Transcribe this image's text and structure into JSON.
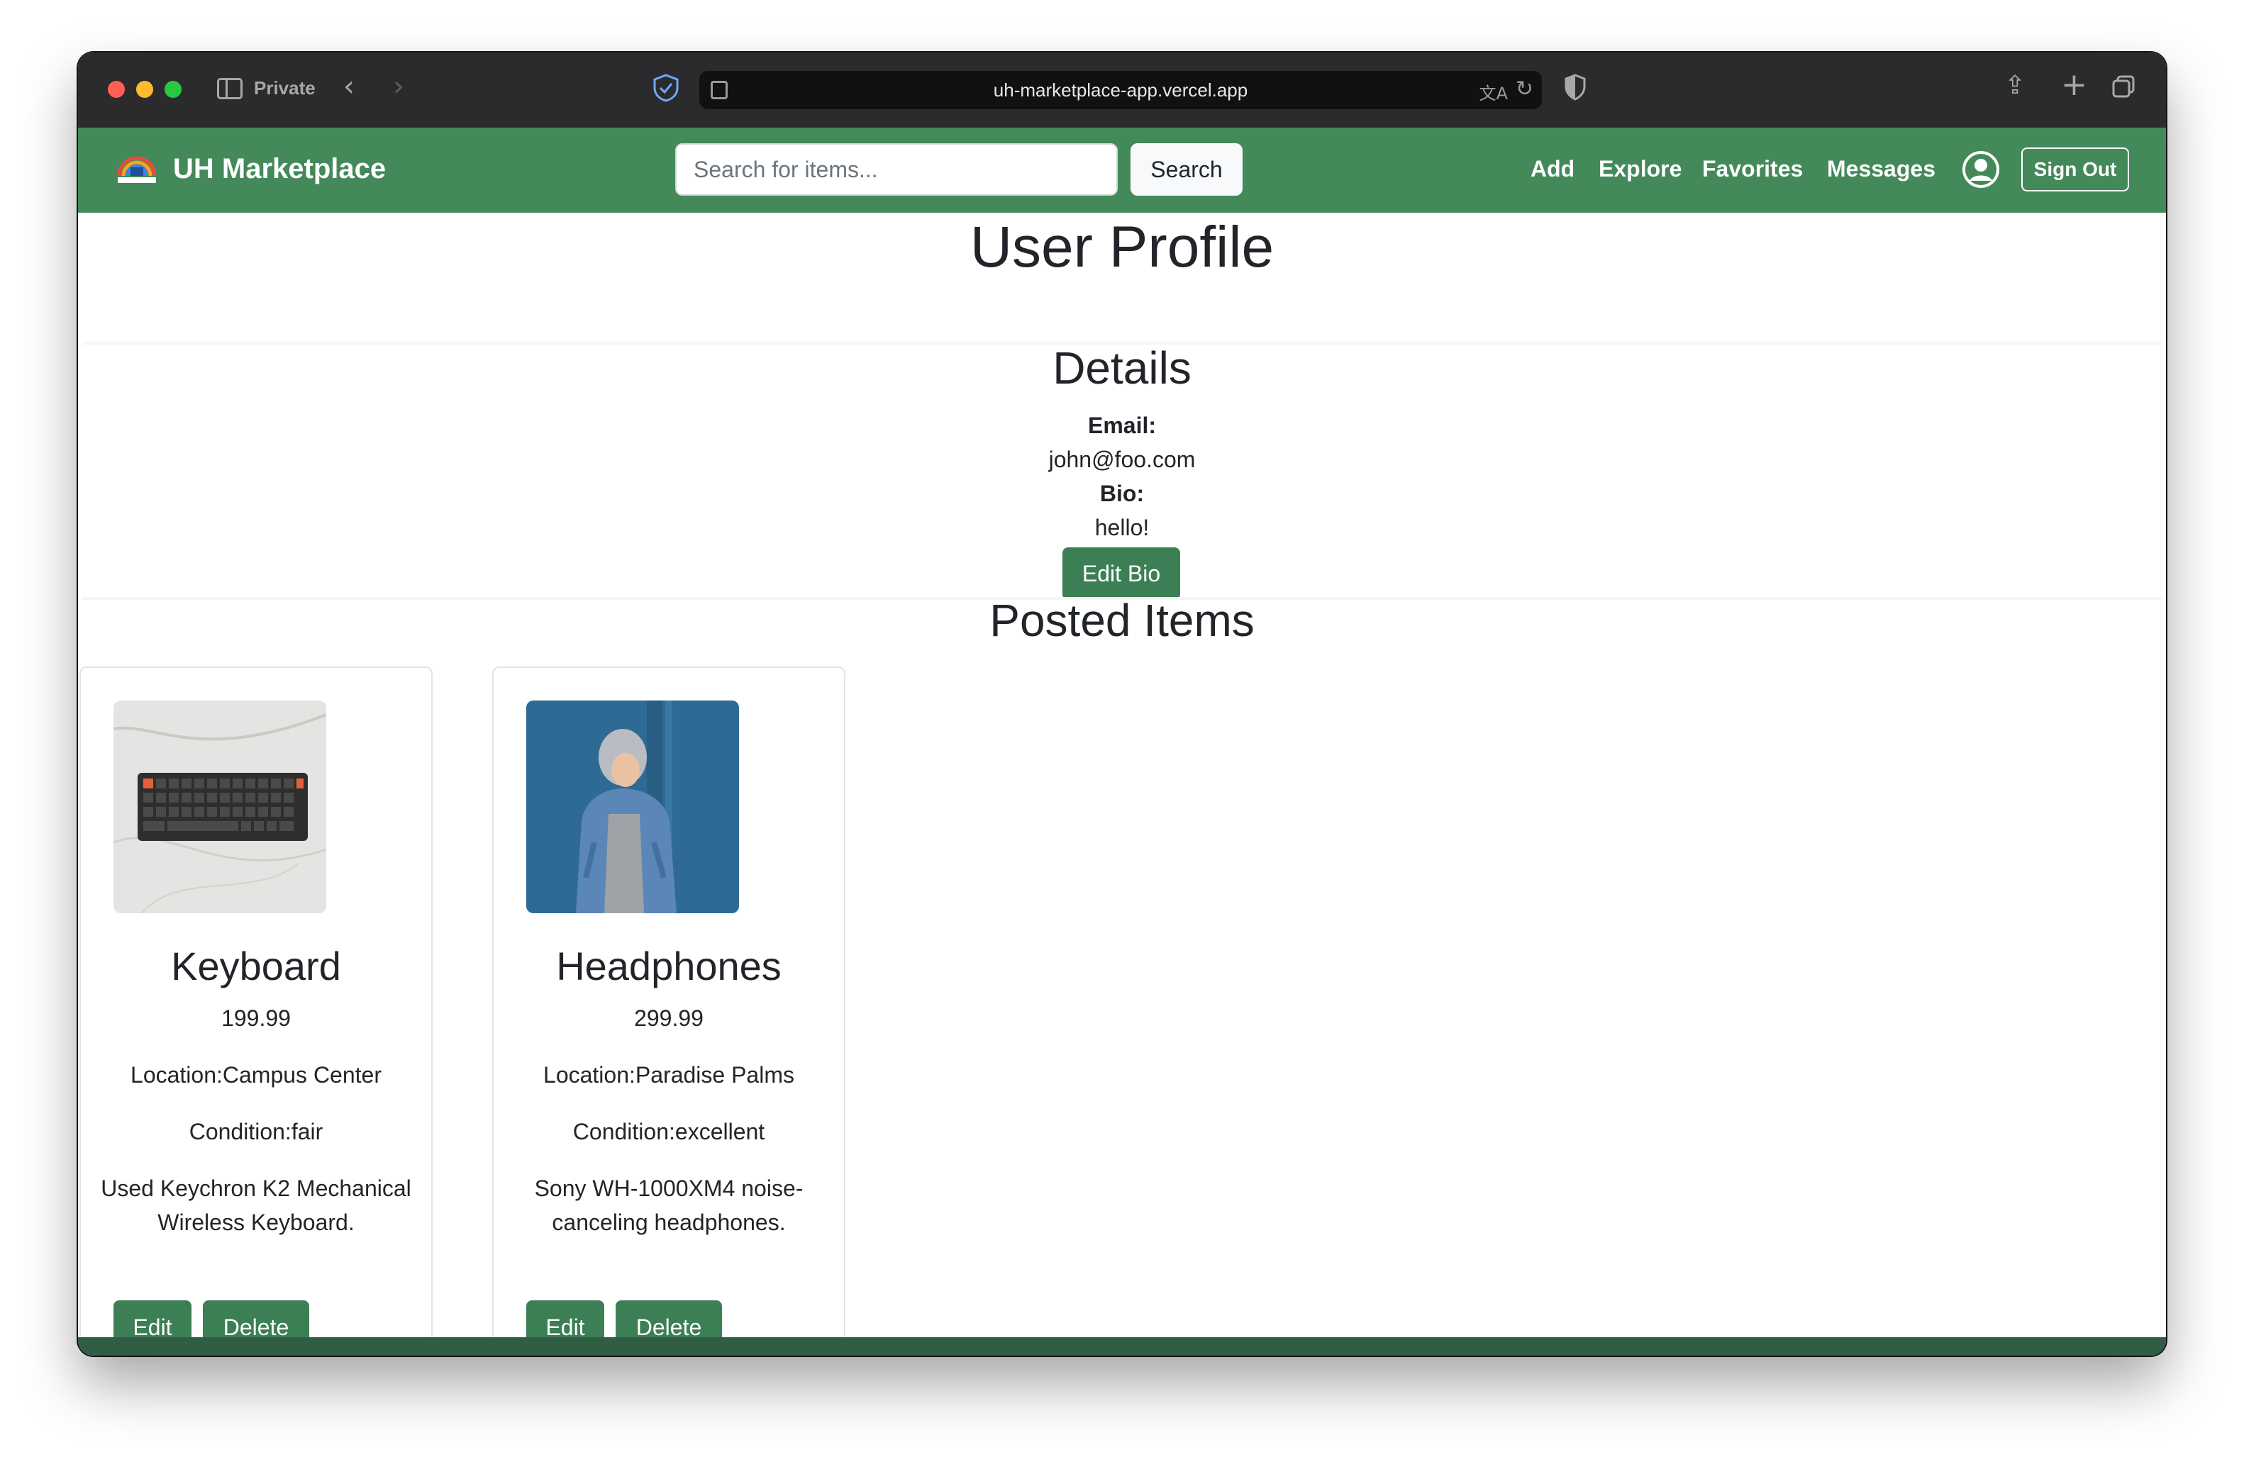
{
  "browser": {
    "private_label": "Private",
    "url": "uh-marketplace-app.vercel.app"
  },
  "navbar": {
    "brand": "UH Marketplace",
    "search_placeholder": "Search for items...",
    "search_label": "Search",
    "links": [
      "Add",
      "Explore",
      "Favorites",
      "Messages"
    ],
    "signout_label": "Sign Out",
    "color": "#438959"
  },
  "profile": {
    "title": "User Profile",
    "details_title": "Details",
    "email_label": "Email:",
    "email": "john@foo.com",
    "bio_label": "Bio:",
    "bio": "hello!",
    "edit_bio_label": "Edit Bio"
  },
  "posted": {
    "title": "Posted Items",
    "items": [
      {
        "name": "Keyboard",
        "price": "199.99",
        "location": "Location:Campus Center",
        "condition": "Condition:fair",
        "description": "Used Keychron K2 Mechanical Wireless Keyboard.",
        "edit_label": "Edit",
        "delete_label": "Delete"
      },
      {
        "name": "Headphones",
        "price": "299.99",
        "location": "Location:Paradise Palms",
        "condition": "Condition:excellent",
        "description": "Sony WH-1000XM4 noise-canceling headphones.",
        "edit_label": "Edit",
        "delete_label": "Delete"
      }
    ]
  },
  "colors": {
    "button": "#3d7f55",
    "footer": "#2f5e45"
  }
}
